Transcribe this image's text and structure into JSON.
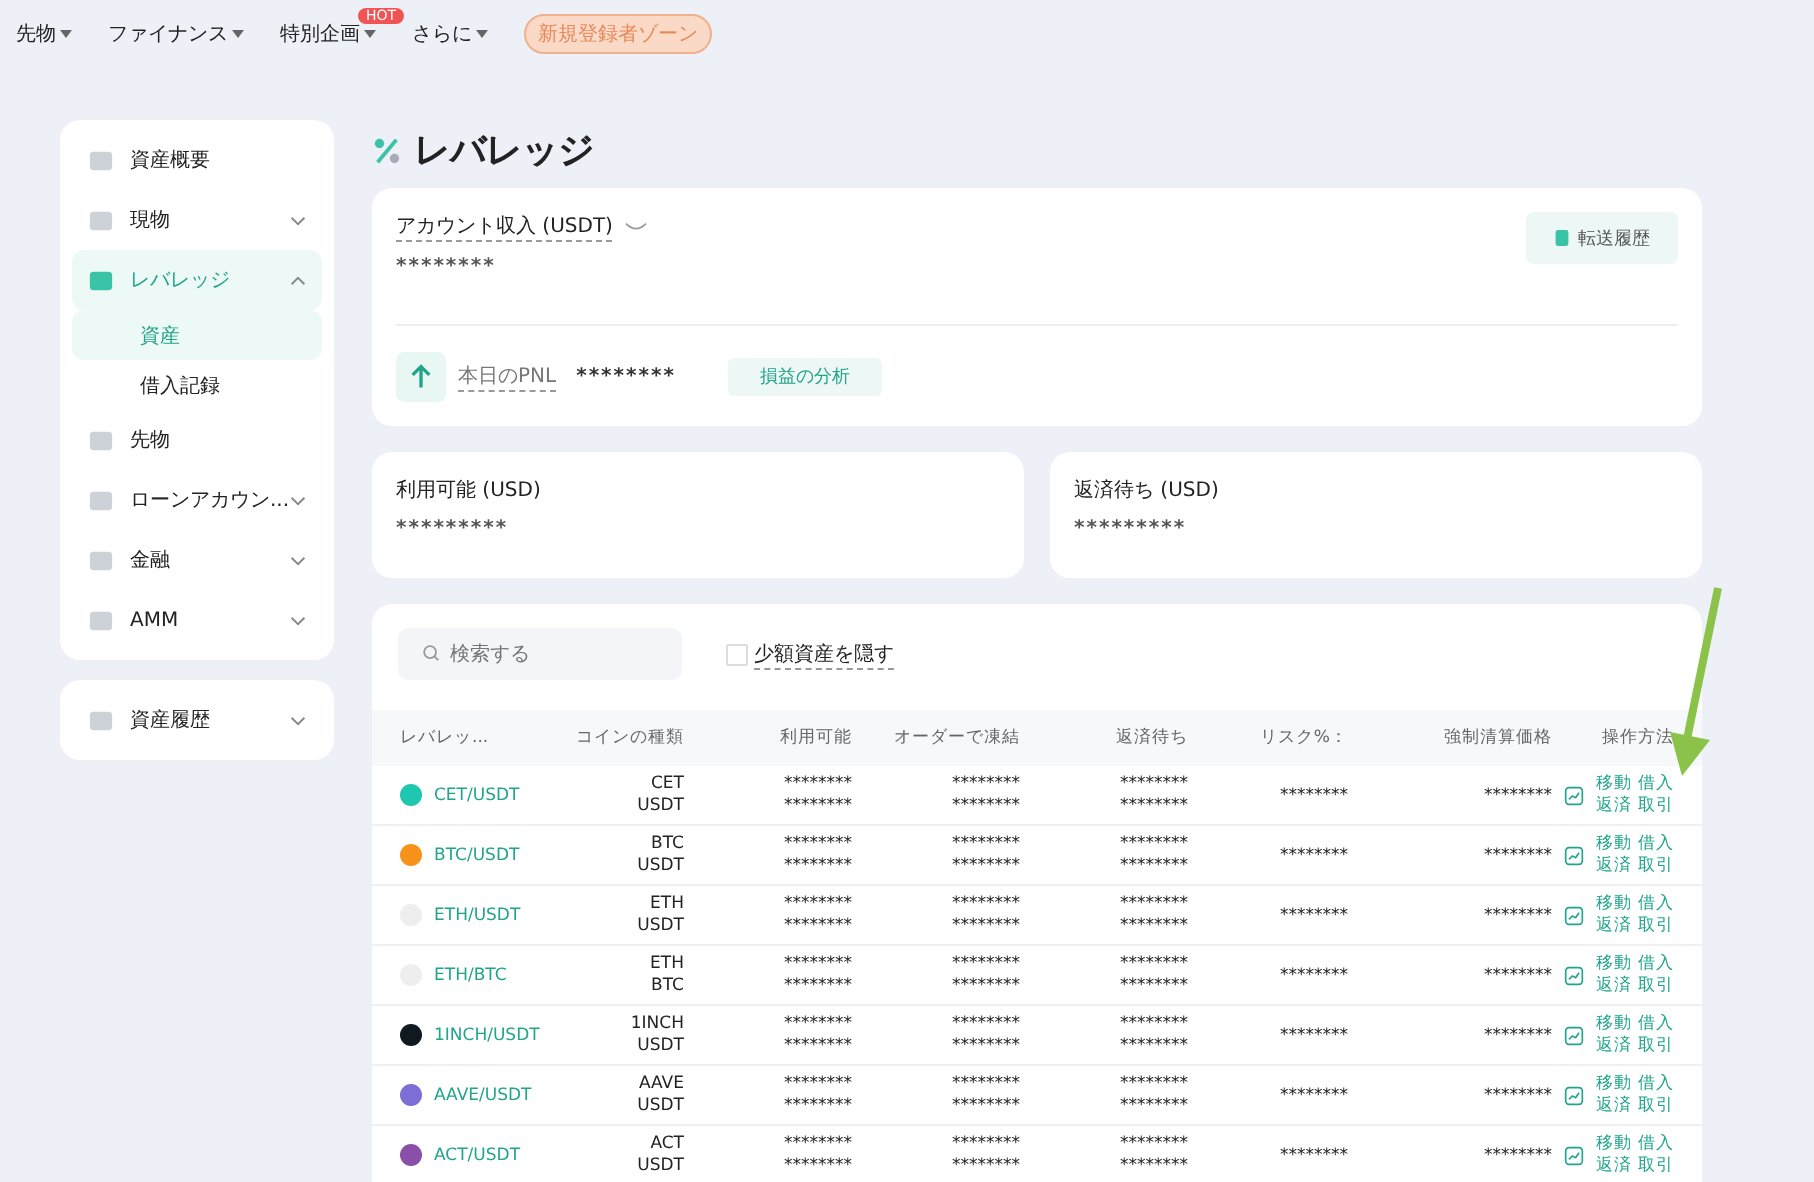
{
  "top_nav": {
    "items": [
      {
        "label": "先物"
      },
      {
        "label": "ファイナンス"
      },
      {
        "label": "特別企画",
        "badge": "HOT"
      },
      {
        "label": "さらに"
      }
    ],
    "promo": "新規登録者ゾーン"
  },
  "sidebar": {
    "groups": [
      {
        "items": [
          {
            "label": "資産概要",
            "expandable": false,
            "selected": false
          },
          {
            "label": "現物",
            "expandable": true,
            "expanded": false,
            "selected": false
          },
          {
            "label": "レバレッジ",
            "expandable": true,
            "expanded": true,
            "selected": true,
            "children": [
              {
                "label": "資産",
                "selected": true
              },
              {
                "label": "借入記録",
                "selected": false
              }
            ]
          },
          {
            "label": "先物",
            "expandable": false,
            "selected": false
          },
          {
            "label": "ローンアカウン...",
            "expandable": true,
            "expanded": false,
            "selected": false
          },
          {
            "label": "金融",
            "expandable": true,
            "expanded": false,
            "selected": false
          },
          {
            "label": "AMM",
            "expandable": true,
            "expanded": false,
            "selected": false
          }
        ]
      },
      {
        "items": [
          {
            "label": "資産履歴",
            "expandable": true,
            "expanded": false,
            "selected": false
          }
        ]
      }
    ]
  },
  "page_title": "レバレッジ",
  "account": {
    "label": "アカウント収入 (USDT)",
    "value": "********",
    "history_button": "転送履歴",
    "pnl_label": "本日のPNL",
    "pnl_value": "********",
    "analysis_button": "損益の分析"
  },
  "balances": [
    {
      "label": "利用可能 (USD)",
      "value": "*********"
    },
    {
      "label": "返済待ち (USD)",
      "value": "*********"
    }
  ],
  "filters": {
    "search_placeholder": "検索する",
    "hide_small": {
      "label": "少額資産を隠す",
      "checked": false
    }
  },
  "table": {
    "columns": [
      "レバレッ...",
      "コインの種類",
      "利用可能",
      "オーダーで凍結",
      "返済待ち",
      "リスク%：",
      "強制清算価格",
      "操作方法"
    ],
    "rows": [
      {
        "pair": "CET/USDT",
        "color": "#1fc7b0",
        "coins": [
          "CET",
          "USDT"
        ],
        "available": [
          "********",
          "********"
        ],
        "frozen": [
          "********",
          "********"
        ],
        "repay": [
          "********",
          "********"
        ],
        "risk": "********",
        "liquidation": "********",
        "actions": [
          "移動",
          "借入",
          "返済",
          "取引"
        ]
      },
      {
        "pair": "BTC/USDT",
        "color": "#f7931a",
        "coins": [
          "BTC",
          "USDT"
        ],
        "available": [
          "********",
          "********"
        ],
        "frozen": [
          "********",
          "********"
        ],
        "repay": [
          "********",
          "********"
        ],
        "risk": "********",
        "liquidation": "********",
        "actions": [
          "移動",
          "借入",
          "返済",
          "取引"
        ]
      },
      {
        "pair": "ETH/USDT",
        "color": "#eeeeee",
        "coins": [
          "ETH",
          "USDT"
        ],
        "available": [
          "********",
          "********"
        ],
        "frozen": [
          "********",
          "********"
        ],
        "repay": [
          "********",
          "********"
        ],
        "risk": "********",
        "liquidation": "********",
        "actions": [
          "移動",
          "借入",
          "返済",
          "取引"
        ]
      },
      {
        "pair": "ETH/BTC",
        "color": "#eeeeee",
        "coins": [
          "ETH",
          "BTC"
        ],
        "available": [
          "********",
          "********"
        ],
        "frozen": [
          "********",
          "********"
        ],
        "repay": [
          "********",
          "********"
        ],
        "risk": "********",
        "liquidation": "********",
        "actions": [
          "移動",
          "借入",
          "返済",
          "取引"
        ]
      },
      {
        "pair": "1INCH/USDT",
        "color": "#101820",
        "coins": [
          "1INCH",
          "USDT"
        ],
        "available": [
          "********",
          "********"
        ],
        "frozen": [
          "********",
          "********"
        ],
        "repay": [
          "********",
          "********"
        ],
        "risk": "********",
        "liquidation": "********",
        "actions": [
          "移動",
          "借入",
          "返済",
          "取引"
        ]
      },
      {
        "pair": "AAVE/USDT",
        "color": "#7b6fd6",
        "coins": [
          "AAVE",
          "USDT"
        ],
        "available": [
          "********",
          "********"
        ],
        "frozen": [
          "********",
          "********"
        ],
        "repay": [
          "********",
          "********"
        ],
        "risk": "********",
        "liquidation": "********",
        "actions": [
          "移動",
          "借入",
          "返済",
          "取引"
        ]
      },
      {
        "pair": "ACT/USDT",
        "color": "#8a4fa8",
        "coins": [
          "ACT",
          "USDT"
        ],
        "available": [
          "********",
          "********"
        ],
        "frozen": [
          "********",
          "********"
        ],
        "repay": [
          "********",
          "********"
        ],
        "risk": "********",
        "liquidation": "********",
        "actions": [
          "移動",
          "借入",
          "返済",
          "取引"
        ]
      }
    ]
  }
}
